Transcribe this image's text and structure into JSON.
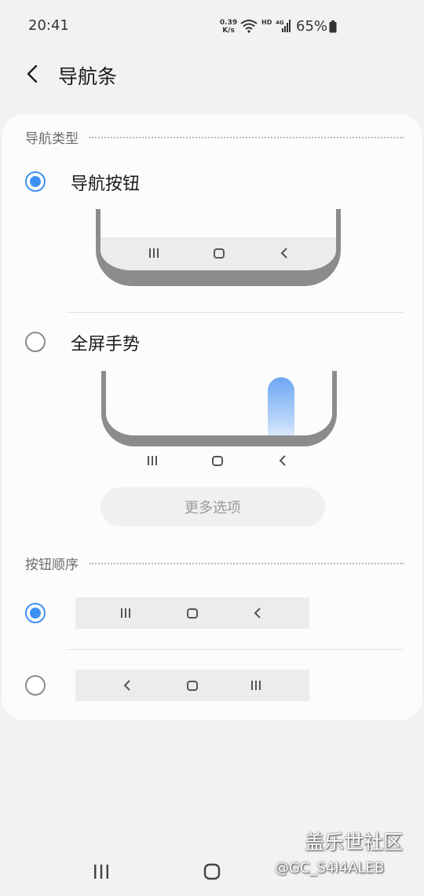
{
  "status_bar": {
    "time": "20:41",
    "speed_value": "0.39",
    "speed_unit": "K/s",
    "hd_label": "HD",
    "network_label": "4G",
    "battery": "65%"
  },
  "header": {
    "title": "导航条",
    "back_icon": "chevron-left-icon"
  },
  "nav_type": {
    "section_label": "导航类型",
    "options": [
      {
        "label": "导航按钮",
        "selected": true
      },
      {
        "label": "全屏手势",
        "selected": false
      }
    ],
    "more_options_label": "更多选项"
  },
  "button_order": {
    "section_label": "按钮顺序",
    "options": [
      {
        "order": [
          "recents",
          "home",
          "back"
        ],
        "selected": true
      },
      {
        "order": [
          "back",
          "home",
          "recents"
        ],
        "selected": false
      }
    ]
  },
  "watermark": {
    "title": "盖乐世社区",
    "subtitle": "@GC_S4I4ALEB"
  },
  "colors": {
    "accent": "#3e91f0",
    "background": "#f2f2f2",
    "card": "#fcfcfc"
  }
}
